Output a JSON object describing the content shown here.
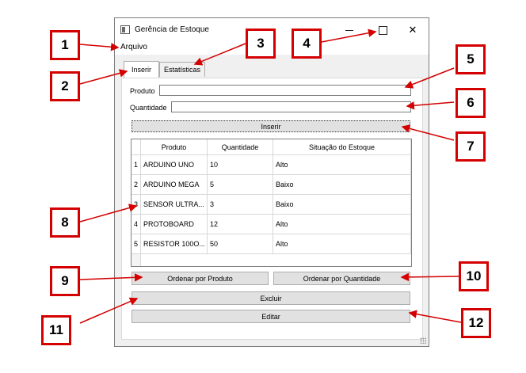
{
  "window": {
    "title": "Gerência de Estoque",
    "controls": {
      "minimize": "—",
      "maximize": "□",
      "close": "✕"
    }
  },
  "menu": {
    "items": [
      "Arquivo"
    ]
  },
  "tabs": [
    {
      "label": "Inserir",
      "active": true
    },
    {
      "label": "Estatísticas",
      "active": false
    }
  ],
  "form": {
    "produto_label": "Produto",
    "produto_value": "",
    "quantidade_label": "Quantidade",
    "quantidade_value": "",
    "insert_button": "Inserir"
  },
  "table": {
    "headers": [
      "Produto",
      "Quantidade",
      "Situação do Estoque"
    ],
    "rows": [
      {
        "num": "1",
        "produto": "ARDUINO UNO",
        "quantidade": "10",
        "situacao": "Alto"
      },
      {
        "num": "2",
        "produto": "ARDUINO MEGA",
        "quantidade": "5",
        "situacao": "Baixo"
      },
      {
        "num": "3",
        "produto": "SENSOR ULTRA...",
        "quantidade": "3",
        "situacao": "Baixo"
      },
      {
        "num": "4",
        "produto": "PROTOBOARD",
        "quantidade": "12",
        "situacao": "Alto"
      },
      {
        "num": "5",
        "produto": "RESISTOR 100O...",
        "quantidade": "50",
        "situacao": "Alto"
      }
    ]
  },
  "buttons": {
    "sort_product": "Ordenar por Produto",
    "sort_quantity": "Ordenar por Quantidade",
    "delete": "Excluir",
    "edit": "Editar"
  },
  "annotations": [
    "1",
    "2",
    "3",
    "4",
    "5",
    "6",
    "7",
    "8",
    "9",
    "10",
    "11",
    "12"
  ],
  "colors": {
    "callout_border": "#d40000",
    "arrow": "#d40000",
    "window_bg": "#f0f0f0",
    "button_bg": "#e1e1e1"
  }
}
